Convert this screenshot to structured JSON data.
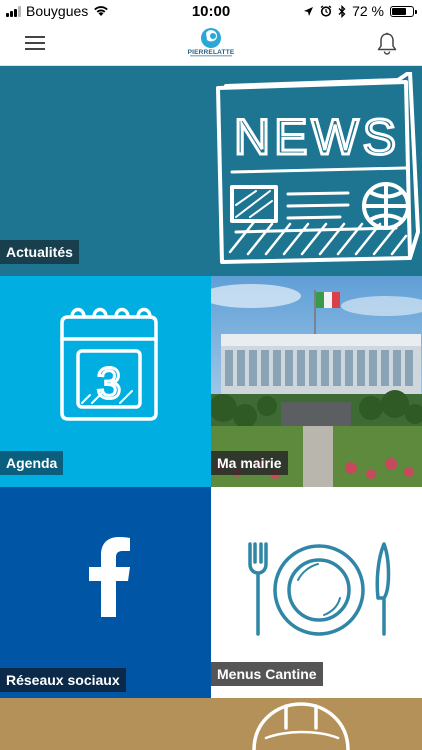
{
  "status_bar": {
    "carrier": "Bouygues",
    "time": "10:00",
    "battery_percent": "72 %",
    "battery_level": 0.72,
    "icons": [
      "signal-icon",
      "wifi-icon",
      "location-icon",
      "alarm-icon",
      "bluetooth-icon",
      "battery-icon"
    ]
  },
  "nav": {
    "menu_icon": "hamburger-icon",
    "logo_text": "PIERRELATTE",
    "notification_icon": "bell-icon"
  },
  "tiles": [
    {
      "id": "news",
      "label": "Actualités",
      "icon": "newspaper-icon",
      "bg": "#1e7591"
    },
    {
      "id": "agenda",
      "label": "Agenda",
      "icon": "calendar-icon",
      "bg": "#00aee1",
      "calendar_day": "3"
    },
    {
      "id": "mairie",
      "label": "Ma mairie",
      "icon": "town-hall-photo"
    },
    {
      "id": "social",
      "label": "Réseaux sociaux",
      "icon": "facebook-icon",
      "bg": "#0055a4"
    },
    {
      "id": "cantine",
      "label": "Menus Cantine",
      "icon": "plate-cutlery-icon",
      "bg": "#ffffff"
    },
    {
      "id": "next",
      "label": "",
      "icon": "helmet-icon",
      "bg": "#b5915a"
    }
  ],
  "news_art_text": "NEWS"
}
